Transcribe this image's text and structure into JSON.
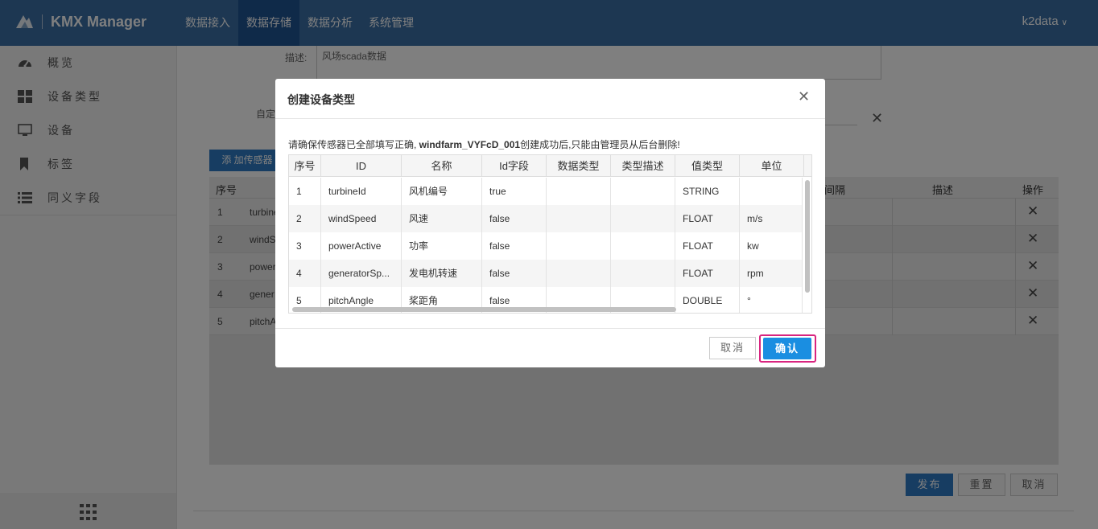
{
  "header": {
    "app_title": "KMX Manager",
    "nav": [
      {
        "label": "数据接入"
      },
      {
        "label": "数据存储"
      },
      {
        "label": "数据分析"
      },
      {
        "label": "系统管理"
      }
    ],
    "user": "k2data",
    "colors": {
      "bar": "#3a6ea5",
      "active": "#1f5593"
    }
  },
  "sidebar": {
    "items": [
      {
        "label": "概览",
        "icon": "dashboard-icon"
      },
      {
        "label": "设备类型",
        "icon": "grid-icon"
      },
      {
        "label": "设备",
        "icon": "monitor-icon"
      },
      {
        "label": "标签",
        "icon": "bookmark-icon"
      },
      {
        "label": "同义字段",
        "icon": "list-icon"
      }
    ],
    "footer_icon": "apps-grid-icon"
  },
  "background_form": {
    "desc_label": "描述:",
    "desc_value": "风场scada数据",
    "custom_label": "自定",
    "add_sensor_label": "添 加传感器",
    "table_headers": {
      "index": "序号",
      "interval": "间隔",
      "desc": "描述",
      "action": "操作"
    },
    "rows": [
      {
        "index": "1",
        "id": "turbine"
      },
      {
        "index": "2",
        "id": "windS"
      },
      {
        "index": "3",
        "id": "power"
      },
      {
        "index": "4",
        "id": "gener"
      },
      {
        "index": "5",
        "id": "pitchA"
      }
    ],
    "publish_label": "发布",
    "reset_label": "重置",
    "cancel_label": "取消"
  },
  "modal": {
    "title": "创建设备类型",
    "warning_prefix": "请确保传感器已全部填写正确, ",
    "warning_id": "windfarm_VYFcD_001",
    "warning_suffix": "创建成功后,只能由管理员从后台删除!",
    "columns": [
      "序号",
      "ID",
      "名称",
      "Id字段",
      "数据类型",
      "类型描述",
      "值类型",
      "单位"
    ],
    "rows": [
      {
        "index": "1",
        "id": "turbineId",
        "name": "风机编号",
        "id_field": "true",
        "data_type": "",
        "type_desc": "",
        "value_type": "STRING",
        "unit": ""
      },
      {
        "index": "2",
        "id": "windSpeed",
        "name": "风速",
        "id_field": "false",
        "data_type": "",
        "type_desc": "",
        "value_type": "FLOAT",
        "unit": "m/s"
      },
      {
        "index": "3",
        "id": "powerActive",
        "name": "功率",
        "id_field": "false",
        "data_type": "",
        "type_desc": "",
        "value_type": "FLOAT",
        "unit": "kw"
      },
      {
        "index": "4",
        "id": "generatorSp...",
        "name": "发电机转速",
        "id_field": "false",
        "data_type": "",
        "type_desc": "",
        "value_type": "FLOAT",
        "unit": "rpm"
      },
      {
        "index": "5",
        "id": "pitchAngle",
        "name": "桨距角",
        "id_field": "false",
        "data_type": "",
        "type_desc": "",
        "value_type": "DOUBLE",
        "unit": "°"
      }
    ],
    "cancel_label": "取消",
    "confirm_label": "确认",
    "confirm_color": "#1a8ee1",
    "highlight_color": "#d8247f"
  }
}
